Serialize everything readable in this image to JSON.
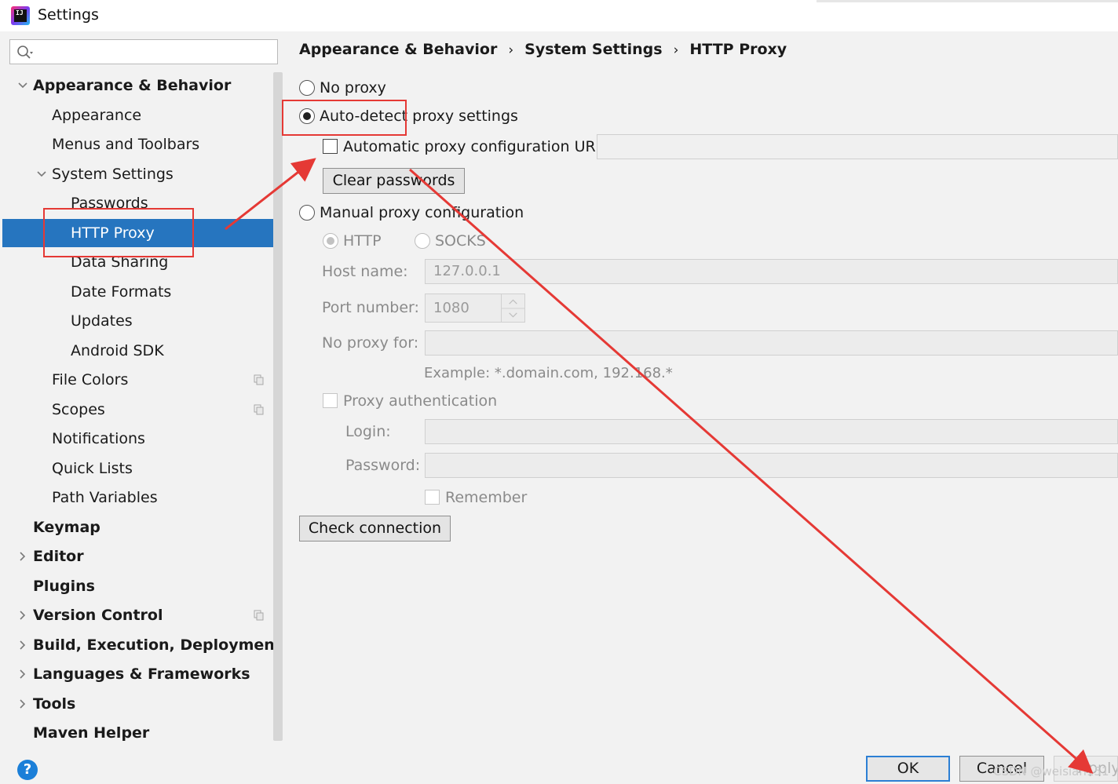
{
  "window": {
    "title": "Settings",
    "app_icon_text": "IJ"
  },
  "search": {
    "placeholder": "",
    "value": ""
  },
  "sidebar": {
    "items": [
      {
        "label": "Appearance & Behavior",
        "level": 0,
        "bold": true,
        "expanded": true
      },
      {
        "label": "Appearance",
        "level": 1
      },
      {
        "label": "Menus and Toolbars",
        "level": 1
      },
      {
        "label": "System Settings",
        "level": 1,
        "expanded": true
      },
      {
        "label": "Passwords",
        "level": 2
      },
      {
        "label": "HTTP Proxy",
        "level": 2,
        "selected": true
      },
      {
        "label": "Data Sharing",
        "level": 2
      },
      {
        "label": "Date Formats",
        "level": 2
      },
      {
        "label": "Updates",
        "level": 2
      },
      {
        "label": "Android SDK",
        "level": 2
      },
      {
        "label": "File Colors",
        "level": 1,
        "copy_icon": true
      },
      {
        "label": "Scopes",
        "level": 1,
        "copy_icon": true
      },
      {
        "label": "Notifications",
        "level": 1
      },
      {
        "label": "Quick Lists",
        "level": 1
      },
      {
        "label": "Path Variables",
        "level": 1
      },
      {
        "label": "Keymap",
        "level": 0,
        "bold": true
      },
      {
        "label": "Editor",
        "level": 0,
        "bold": true,
        "collapsed": true
      },
      {
        "label": "Plugins",
        "level": 0,
        "bold": true
      },
      {
        "label": "Version Control",
        "level": 0,
        "bold": true,
        "collapsed": true,
        "copy_icon": true
      },
      {
        "label": "Build, Execution, Deployment",
        "level": 0,
        "bold": true,
        "collapsed": true
      },
      {
        "label": "Languages & Frameworks",
        "level": 0,
        "bold": true,
        "collapsed": true
      },
      {
        "label": "Tools",
        "level": 0,
        "bold": true,
        "collapsed": true
      },
      {
        "label": "Maven Helper",
        "level": 0,
        "bold": true
      }
    ]
  },
  "breadcrumb": {
    "items": [
      "Appearance & Behavior",
      "System Settings",
      "HTTP Proxy"
    ],
    "separator": "›"
  },
  "proxy": {
    "no_proxy_label": "No proxy",
    "auto_detect_label": "Auto-detect proxy settings",
    "auto_config_url_label": "Automatic proxy configuration URL:",
    "auto_config_url_value": "",
    "clear_passwords_label": "Clear passwords",
    "manual_label": "Manual proxy configuration",
    "http_label": "HTTP",
    "socks_label": "SOCKS",
    "host_label": "Host name:",
    "host_value": "127.0.0.1",
    "port_label": "Port number:",
    "port_value": "1080",
    "no_proxy_for_label": "No proxy for:",
    "no_proxy_for_value": "",
    "example_text": "Example: *.domain.com, 192.168.*",
    "proxy_auth_label": "Proxy authentication",
    "login_label": "Login:",
    "login_value": "",
    "password_label": "Password:",
    "password_value": "",
    "remember_label": "Remember",
    "check_connection_label": "Check connection",
    "selected_mode": "auto-detect"
  },
  "footer": {
    "help_label": "?",
    "ok_label": "OK",
    "cancel_label": "Cancel",
    "apply_label": "Apply",
    "watermark": "CSDN @weisian151"
  },
  "colors": {
    "selection": "#2675bf",
    "annotation": "#e53935",
    "panel": "#f2f2f2",
    "help": "#1b7fd8"
  }
}
